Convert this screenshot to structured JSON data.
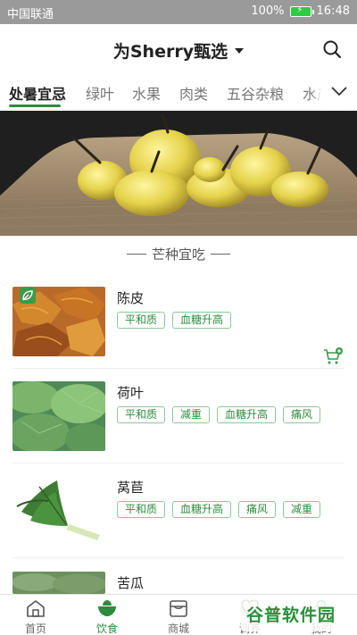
{
  "status_bar": {
    "carrier": "中国联通",
    "battery": "100%",
    "time": "16:48"
  },
  "header": {
    "title": "为Sherry甄选",
    "search_icon": "search-icon"
  },
  "tabs": [
    {
      "label": "处暑宜忌",
      "active": true
    },
    {
      "label": "绿叶"
    },
    {
      "label": "水果"
    },
    {
      "label": "肉类"
    },
    {
      "label": "五谷杂粮"
    },
    {
      "label": "水产"
    }
  ],
  "section": {
    "title": "芒种宜吃"
  },
  "items": [
    {
      "name": "陈皮",
      "tags": [
        "平和质",
        "血糖升高"
      ],
      "badge_icon": "leaf-icon",
      "cart_icon": "add-to-cart-icon"
    },
    {
      "name": "荷叶",
      "tags": [
        "平和质",
        "减重",
        "血糖升高",
        "痛风"
      ]
    },
    {
      "name": "莴苣",
      "tags": [
        "平和质",
        "血糖升高",
        "痛风",
        "减重"
      ]
    },
    {
      "name": "苦瓜",
      "tags": []
    }
  ],
  "bottom_nav": [
    {
      "label": "首页",
      "icon": "home-icon"
    },
    {
      "label": "饮食",
      "icon": "food-icon",
      "active": true
    },
    {
      "label": "商城",
      "icon": "store-icon"
    },
    {
      "label": "调养",
      "icon": "care-icon"
    },
    {
      "label": "我的",
      "icon": "user-icon"
    }
  ],
  "watermark": {
    "text": "谷普软件园"
  },
  "colors": {
    "accent": "#2e8b3e",
    "status_bar": "#9a9a9a"
  }
}
